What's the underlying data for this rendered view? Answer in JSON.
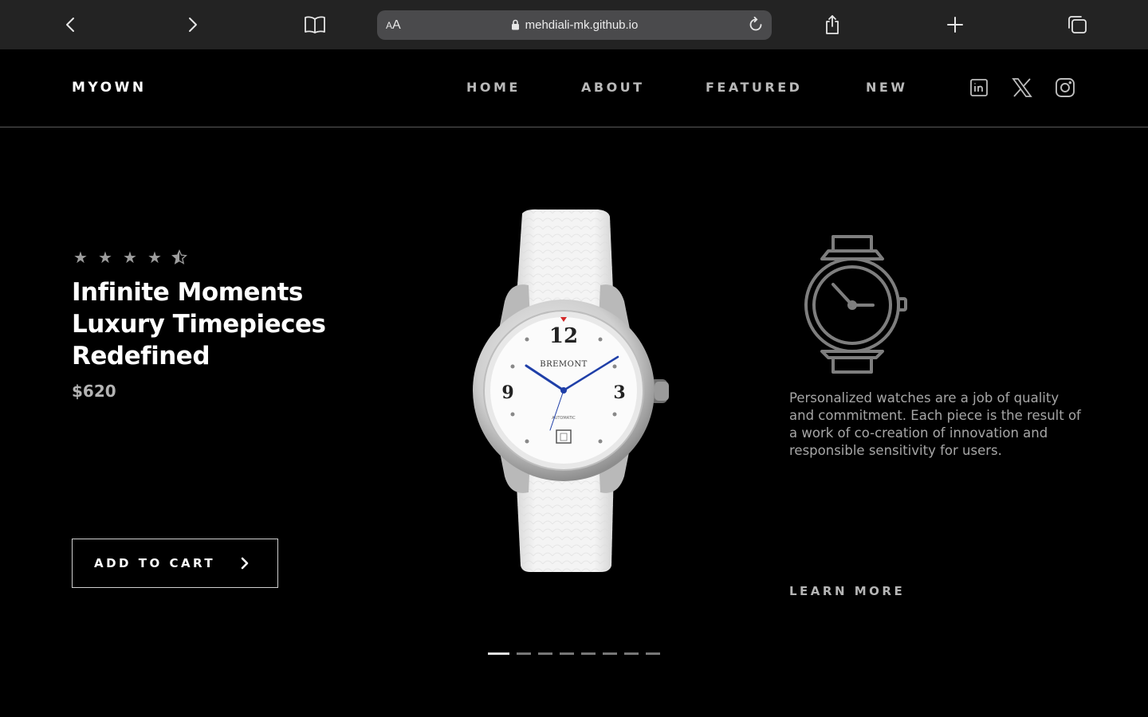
{
  "browser": {
    "reader_small": "A",
    "reader_big": "A",
    "url": "mehdiali-mk.github.io",
    "icons": [
      "back-icon",
      "forward-icon",
      "bookmarks-icon",
      "lock-icon",
      "reload-icon",
      "share-icon",
      "new-tab-icon",
      "tabs-icon"
    ]
  },
  "site": {
    "logo": "MYOWN",
    "nav": [
      "HOME",
      "ABOUT",
      "FEATURED",
      "NEW"
    ],
    "social": [
      "linkedin-icon",
      "x-icon",
      "instagram-icon"
    ]
  },
  "hero": {
    "rating": 4.5,
    "rating_max": 5,
    "title_lines": [
      "Infinite Moments",
      "Luxury Timepieces",
      "Redefined"
    ],
    "price": "$620",
    "cta": "ADD TO CART",
    "watch_brand": "BREMONT",
    "watch_dial_text": "AUTOMATIC",
    "watch_numerals": [
      "12",
      "3",
      "9"
    ],
    "description": "Personalized watches are a job of quality and commitment. Each piece is the result of a work of co-creation of innovation and responsible sensitivity for users.",
    "learn_more": "LEARN MORE"
  },
  "slider": {
    "count": 8,
    "active_index": 0
  },
  "colors": {
    "background": "#000000",
    "chrome": "#232323",
    "watch_hands": "#1f3fa8",
    "marker": "#d42a2a"
  }
}
